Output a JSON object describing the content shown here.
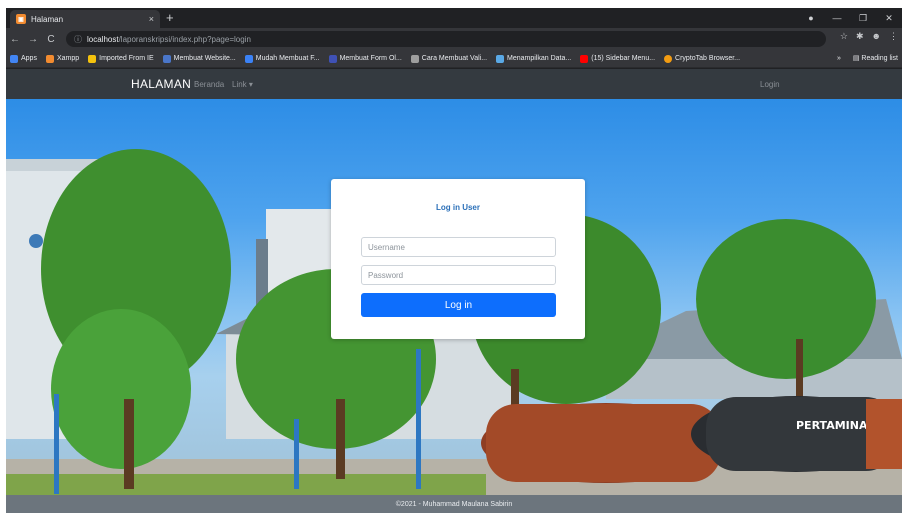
{
  "browser": {
    "tab_title": "Halaman",
    "tab_close": "×",
    "new_tab": "+",
    "url_host": "localhost",
    "url_path": "/laporanskripsi/index.php?page=login",
    "bookmarks": [
      {
        "label": "Apps",
        "color": "#4285f4"
      },
      {
        "label": "Xampp",
        "color": "#f28b30"
      },
      {
        "label": "Imported From IE",
        "color": "#f4c20d"
      },
      {
        "label": "Membuat Website...",
        "color": "#4a76c9"
      },
      {
        "label": "Mudah Membuat F...",
        "color": "#3b82f6"
      },
      {
        "label": "Membuat Form Ol...",
        "color": "#3f51b5"
      },
      {
        "label": "Cara Membuat Vali...",
        "color": "#9e9e9e"
      },
      {
        "label": "Menampilkan Data...",
        "color": "#5aa9e6"
      },
      {
        "label": "(15) Sidebar Menu...",
        "color": "#ff0000"
      },
      {
        "label": "CryptoTab Browser...",
        "color": "#f39c12"
      }
    ],
    "bookmarks_more": "»",
    "reading_list": "Reading list"
  },
  "navbar": {
    "brand": "HALAMAN",
    "links": [
      "Beranda",
      "Link ▾"
    ],
    "login": "Login"
  },
  "login_card": {
    "title": "Log in User",
    "username_placeholder": "Username",
    "password_placeholder": "Password",
    "button": "Log in"
  },
  "footer": {
    "text": "©2021 - Muhammad Maulana Sabirin"
  },
  "colors": {
    "navbar_bg": "#343a40",
    "primary": "#0d6efd",
    "footer_bg": "#6c757d",
    "card_title": "#2a6fb8"
  }
}
